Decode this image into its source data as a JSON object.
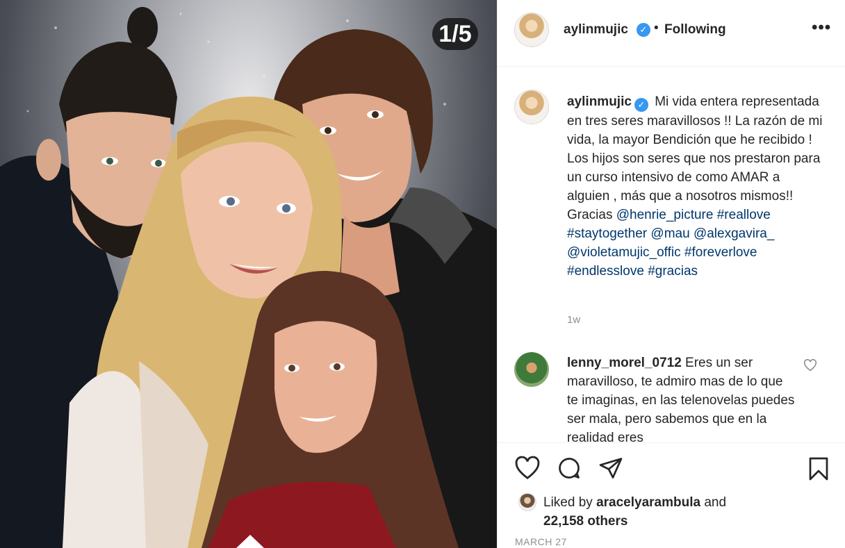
{
  "media": {
    "counter": "1/5",
    "image_desc_icon": "family-portrait-illustration"
  },
  "header": {
    "username": "aylinmujic",
    "verified_icon": "verified-badge-icon",
    "dot": "•",
    "follow_label": "Following",
    "more_label": "•••"
  },
  "caption": {
    "username": "aylinmujic",
    "text_part1": "Mi vida entera representada en tres seres maravillosos !! La razón de mi vida, la mayor Bendición que he recibido ! Los hijos son seres que nos prestaron para un curso intensivo de como AMAR a alguien , más que a nosotros mismos!! Gracias",
    "tags": [
      "@henrie_picture",
      "#reallove",
      "#staytogether",
      "@mau",
      "@alexgavira_",
      "@violetamujic_offic",
      "#foreverlove",
      "#endlesslove",
      "#gracias"
    ],
    "time": "1w"
  },
  "comment": {
    "username": "lenny_morel_0712",
    "text": "Eres un ser maravilloso, te admiro mas de lo que te imaginas, en las telenovelas puedes ser mala, pero sabemos que en la realidad eres"
  },
  "actions": {
    "liked_by_label": "Liked by",
    "liked_by_user": "aracelyarambula",
    "and_label": "and",
    "others_count": "22,158 others",
    "date": "MARCH 27"
  },
  "colors": {
    "link": "#00376b",
    "verified": "#3897f0",
    "muted": "#8e8e8e",
    "text": "#262626"
  }
}
